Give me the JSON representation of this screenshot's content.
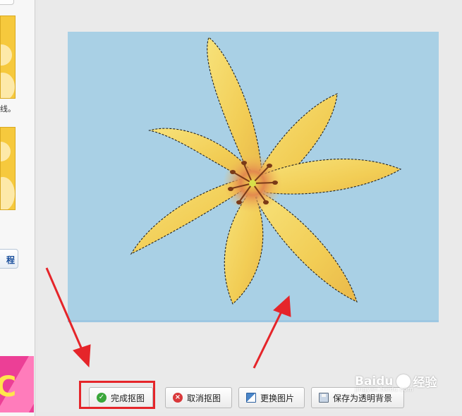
{
  "sidebar": {
    "caption_fragment": "线。",
    "button_fragment": "程",
    "promo_glyph": "C",
    "thumb_color": "#f6c93d"
  },
  "canvas": {
    "background_color": "#a9d0e5",
    "subject": "yellow-lily",
    "selection": "marching-ants"
  },
  "toolbar": {
    "complete_label": "完成抠图",
    "cancel_label": "取消抠图",
    "change_image_label": "更换图片",
    "save_transparent_label": "保存为透明背景"
  },
  "annotation": {
    "highlight_color": "#e5252a",
    "arrow_color": "#e5252a"
  },
  "watermark": {
    "brand": "Baidu",
    "brand_suffix": "经验",
    "url": "jingyan.baidu.com"
  }
}
